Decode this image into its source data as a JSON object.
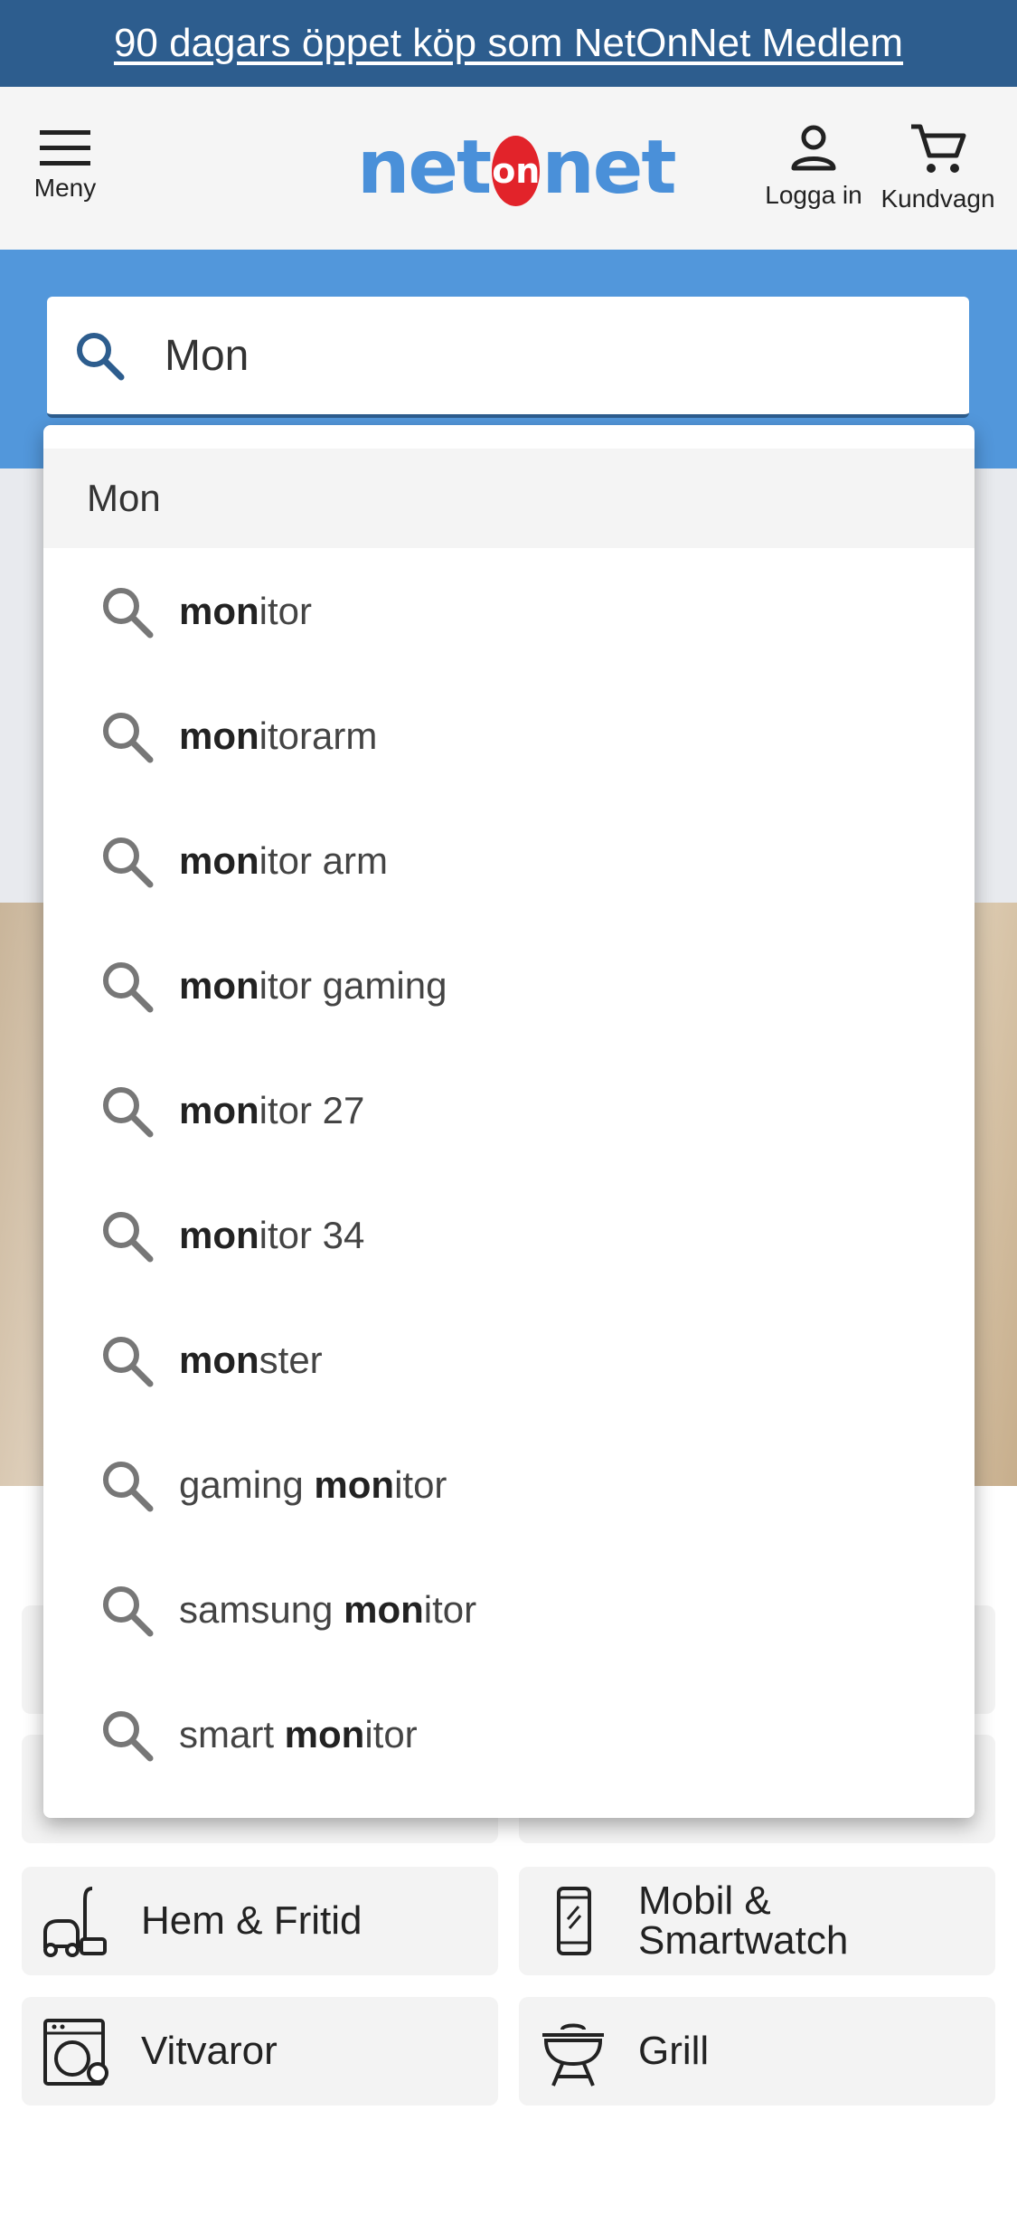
{
  "promo": {
    "text": "90 dagars öppet köp som NetOnNet Medlem"
  },
  "header": {
    "menu_label": "Meny",
    "logo": {
      "left": "net",
      "middle": "on",
      "right": "net"
    },
    "login_label": "Logga in",
    "cart_label": "Kundvagn"
  },
  "search": {
    "value": "Mon"
  },
  "dropdown": {
    "current_query": "Mon",
    "suggestions": [
      {
        "pre": "",
        "bold": "mon",
        "post": "itor"
      },
      {
        "pre": "",
        "bold": "mon",
        "post": "itorarm"
      },
      {
        "pre": "",
        "bold": "mon",
        "post": "itor arm"
      },
      {
        "pre": "",
        "bold": "mon",
        "post": "itor gaming"
      },
      {
        "pre": "",
        "bold": "mon",
        "post": "itor 27"
      },
      {
        "pre": "",
        "bold": "mon",
        "post": "itor 34"
      },
      {
        "pre": "",
        "bold": "mon",
        "post": "ster"
      },
      {
        "pre": "gaming ",
        "bold": "mon",
        "post": "itor"
      },
      {
        "pre": "samsung ",
        "bold": "mon",
        "post": "itor"
      },
      {
        "pre": "smart ",
        "bold": "mon",
        "post": "itor"
      }
    ]
  },
  "categories": [
    {
      "label": "Hem & Fritid",
      "icon": "vacuum-cleaner-icon"
    },
    {
      "label": "Mobil & Smartwatch",
      "label_line1": "Mobil &",
      "label_line2": "Smartwatch",
      "icon": "smartphone-icon"
    },
    {
      "label": "Vitvaror",
      "icon": "washing-machine-icon"
    },
    {
      "label": "Grill",
      "icon": "grill-icon"
    }
  ],
  "colors": {
    "promo_bg": "#2d5d8e",
    "search_band": "#5297db",
    "logo_blue": "#4a90d9",
    "logo_red": "#e2232a"
  }
}
